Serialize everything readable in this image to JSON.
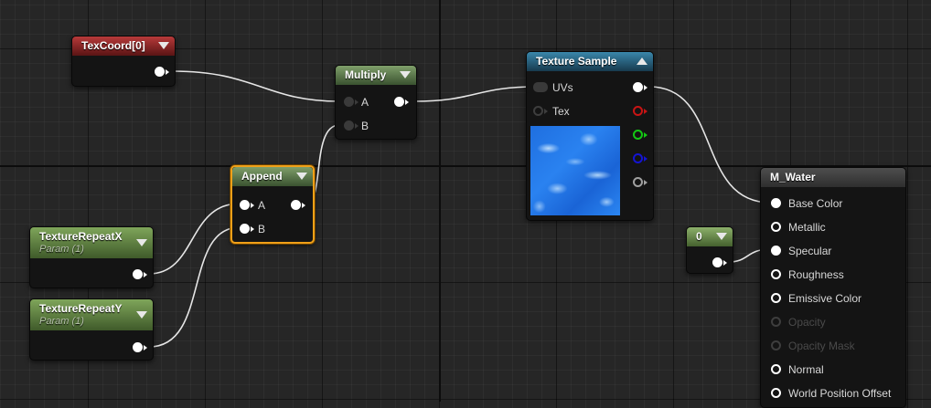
{
  "nodes": {
    "texcoord": {
      "title": "TexCoord[0]"
    },
    "multiply": {
      "title": "Multiply",
      "in_a": "A",
      "in_b": "B"
    },
    "append": {
      "title": "Append",
      "in_a": "A",
      "in_b": "B"
    },
    "repeat_x": {
      "title": "TextureRepeatX",
      "subtitle": "Param (1)"
    },
    "repeat_y": {
      "title": "TextureRepeatY",
      "subtitle": "Param (1)"
    },
    "texture_sample": {
      "title": "Texture Sample",
      "in_uvs": "UVs",
      "in_tex": "Tex"
    },
    "constant": {
      "title": "0"
    },
    "material": {
      "title": "M_Water",
      "inputs": [
        "Base Color",
        "Metallic",
        "Specular",
        "Roughness",
        "Emissive Color",
        "Opacity",
        "Opacity Mask",
        "Normal",
        "World Position Offset"
      ]
    }
  },
  "colors": {
    "wire": "#ffffff",
    "selection": "#f0a018",
    "pin_red": "#c81414",
    "pin_green": "#14c814",
    "pin_blue": "#1414d2"
  }
}
